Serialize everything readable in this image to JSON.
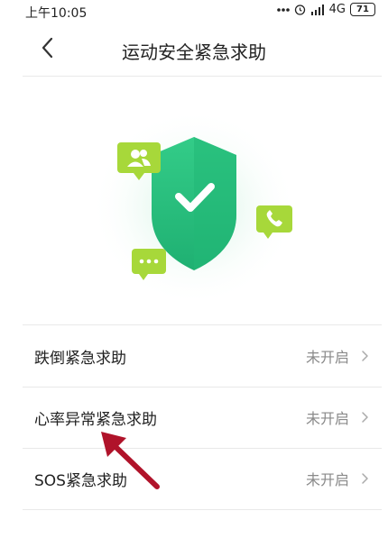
{
  "status_bar": {
    "time": "上午10:05",
    "icons": [
      "more-dots-icon",
      "alarm-icon",
      "signal-icon"
    ],
    "network": "4G",
    "battery": "71"
  },
  "header": {
    "title": "运动安全紧急求助",
    "back_icon": "chevron-left-icon"
  },
  "hero": {
    "shield_color": "#2ec27e",
    "badge_color": "#a7d83a",
    "badges": [
      "contacts-icon",
      "phone-icon",
      "message-icon"
    ]
  },
  "settings": [
    {
      "label": "跌倒紧急求助",
      "value": "未开启"
    },
    {
      "label": "心率异常紧急求助",
      "value": "未开启"
    },
    {
      "label": "SOS紧急求助",
      "value": "未开启"
    }
  ],
  "annotation": {
    "arrow_color": "#b0132a"
  }
}
